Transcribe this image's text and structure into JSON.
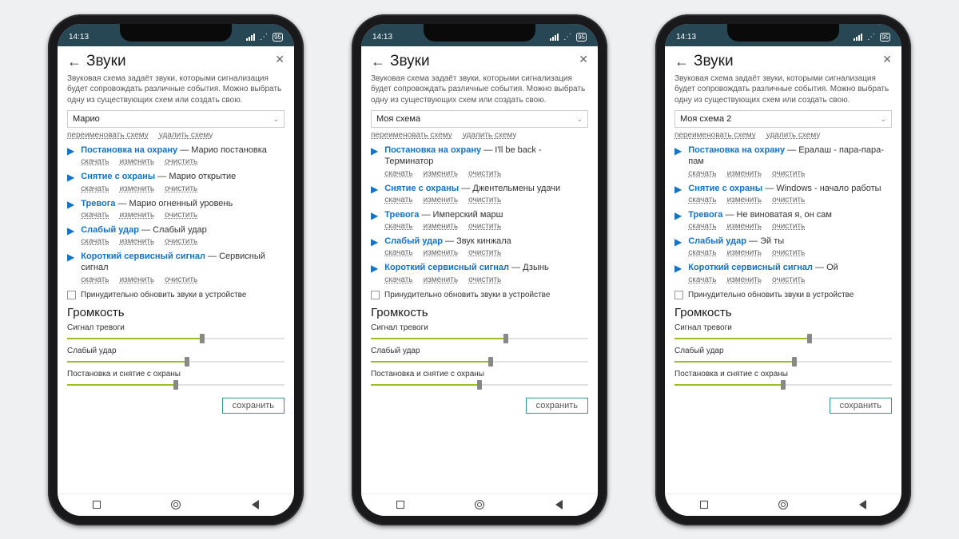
{
  "status": {
    "time": "14:13",
    "battery": "95"
  },
  "page": {
    "title": "Звуки",
    "description": "Звуковая схема задаёт звуки, которыми сигнализация будет сопровождать различные события. Можно выбрать одну из существующих схем или создать свою.",
    "rename": "переименовать схему",
    "delete": "удалить схему",
    "download": "скачать",
    "edit": "изменить",
    "clear": "очистить",
    "force_update": "Принудительно обновить звуки в устройстве",
    "volume_title": "Громкость",
    "save": "сохранить"
  },
  "sliders": [
    {
      "label": "Сигнал тревоги",
      "value": 0.62
    },
    {
      "label": "Слабый удар",
      "value": 0.55
    },
    {
      "label": "Постановка и снятие с охраны",
      "value": 0.5
    }
  ],
  "phones": [
    {
      "scheme": "Марио",
      "sounds": [
        {
          "event": "Постановка на охрану",
          "value": "Марио постановка"
        },
        {
          "event": "Снятие с охраны",
          "value": "Марио открытие"
        },
        {
          "event": "Тревога",
          "value": "Марио огненный уровень"
        },
        {
          "event": "Слабый удар",
          "value": "Слабый удар"
        },
        {
          "event": "Короткий сервисный сигнал",
          "value": "Сервисный сигнал"
        }
      ]
    },
    {
      "scheme": "Моя схема",
      "sounds": [
        {
          "event": "Постановка на охрану",
          "value": "I'll be back - Терминатор"
        },
        {
          "event": "Снятие с охраны",
          "value": "Джентельмены удачи"
        },
        {
          "event": "Тревога",
          "value": "Имперский марш"
        },
        {
          "event": "Слабый удар",
          "value": "Звук кинжала"
        },
        {
          "event": "Короткий сервисный сигнал",
          "value": "Дзынь"
        }
      ]
    },
    {
      "scheme": "Моя схема 2",
      "sounds": [
        {
          "event": "Постановка на охрану",
          "value": "Ералаш - пара-пара-пам"
        },
        {
          "event": "Снятие с охраны",
          "value": "Windows - начало работы"
        },
        {
          "event": "Тревога",
          "value": "Не виноватая я, он сам"
        },
        {
          "event": "Слабый удар",
          "value": "Эй ты"
        },
        {
          "event": "Короткий сервисный сигнал",
          "value": "Ой"
        }
      ]
    }
  ]
}
